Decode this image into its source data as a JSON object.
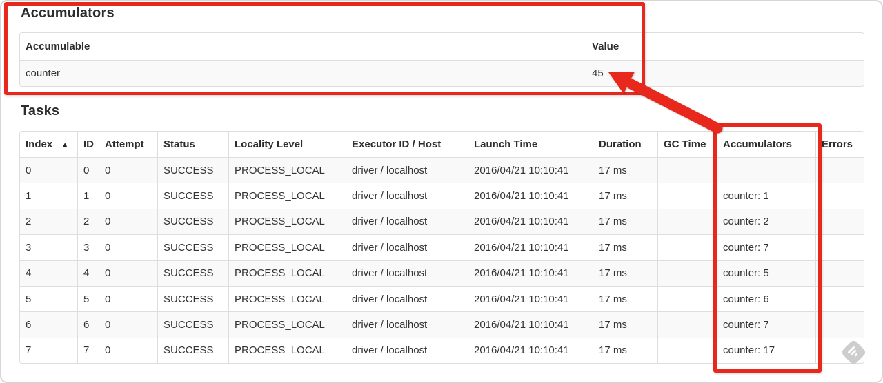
{
  "colors": {
    "annotation_red": "#e8281c",
    "table_border": "#dddddd",
    "row_stripe": "#f9f9f9",
    "text": "#333333"
  },
  "accumulators_section": {
    "title": "Accumulators",
    "table": {
      "headers": [
        "Accumulable",
        "Value"
      ],
      "rows": [
        [
          "counter",
          "45"
        ]
      ]
    }
  },
  "tasks_section": {
    "title": "Tasks",
    "sort_icon": "▲",
    "table": {
      "headers": [
        "Index",
        "ID",
        "Attempt",
        "Status",
        "Locality Level",
        "Executor ID / Host",
        "Launch Time",
        "Duration",
        "GC Time",
        "Accumulators",
        "Errors"
      ],
      "rows": [
        [
          "0",
          "0",
          "0",
          "SUCCESS",
          "PROCESS_LOCAL",
          "driver / localhost",
          "2016/04/21 10:10:41",
          "17 ms",
          "",
          "",
          ""
        ],
        [
          "1",
          "1",
          "0",
          "SUCCESS",
          "PROCESS_LOCAL",
          "driver / localhost",
          "2016/04/21 10:10:41",
          "17 ms",
          "",
          "counter: 1",
          ""
        ],
        [
          "2",
          "2",
          "0",
          "SUCCESS",
          "PROCESS_LOCAL",
          "driver / localhost",
          "2016/04/21 10:10:41",
          "17 ms",
          "",
          "counter: 2",
          ""
        ],
        [
          "3",
          "3",
          "0",
          "SUCCESS",
          "PROCESS_LOCAL",
          "driver / localhost",
          "2016/04/21 10:10:41",
          "17 ms",
          "",
          "counter: 7",
          ""
        ],
        [
          "4",
          "4",
          "0",
          "SUCCESS",
          "PROCESS_LOCAL",
          "driver / localhost",
          "2016/04/21 10:10:41",
          "17 ms",
          "",
          "counter: 5",
          ""
        ],
        [
          "5",
          "5",
          "0",
          "SUCCESS",
          "PROCESS_LOCAL",
          "driver / localhost",
          "2016/04/21 10:10:41",
          "17 ms",
          "",
          "counter: 6",
          ""
        ],
        [
          "6",
          "6",
          "0",
          "SUCCESS",
          "PROCESS_LOCAL",
          "driver / localhost",
          "2016/04/21 10:10:41",
          "17 ms",
          "",
          "counter: 7",
          ""
        ],
        [
          "7",
          "7",
          "0",
          "SUCCESS",
          "PROCESS_LOCAL",
          "driver / localhost",
          "2016/04/21 10:10:41",
          "17 ms",
          "",
          "counter: 17",
          ""
        ]
      ]
    }
  }
}
